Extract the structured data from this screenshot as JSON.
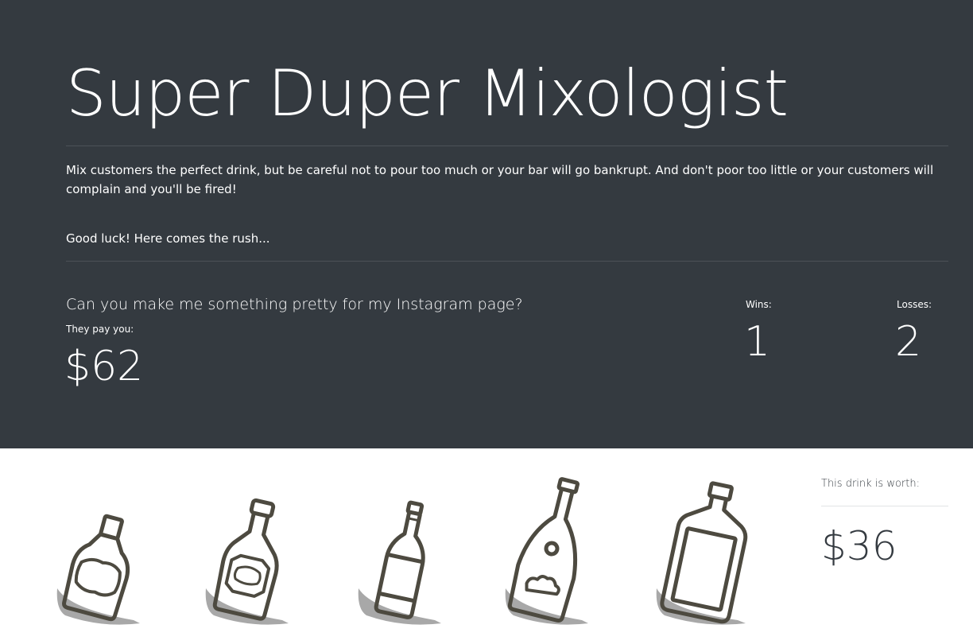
{
  "header": {
    "title": "Super Duper Mixologist",
    "intro": "Mix customers the perfect drink, but be careful not to pour too much or your bar will go bankrupt. And don't poor too little or your customers will complain and you'll be fired!",
    "tagline": "Good luck! Here comes the rush..."
  },
  "order": {
    "request": "Can you make me something pretty for my Instagram page?",
    "pay_label": "They pay you:",
    "pay_value": "$62"
  },
  "score": {
    "wins_label": "Wins:",
    "wins_value": "1",
    "losses_label": "Losses:",
    "losses_value": "2"
  },
  "drink": {
    "worth_label": "This drink is worth:",
    "worth_value": "$36"
  },
  "bottles": [
    {
      "icon": "whiskey-bottle-icon"
    },
    {
      "icon": "liqueur-bottle-icon"
    },
    {
      "icon": "beer-bottle-icon"
    },
    {
      "icon": "cognac-bottle-icon"
    },
    {
      "icon": "flask-bottle-icon"
    }
  ],
  "colors": {
    "hero_background": "#343a40",
    "bottle_stroke": "#4d4a40",
    "bottle_shadow": "#a8a8a8"
  }
}
